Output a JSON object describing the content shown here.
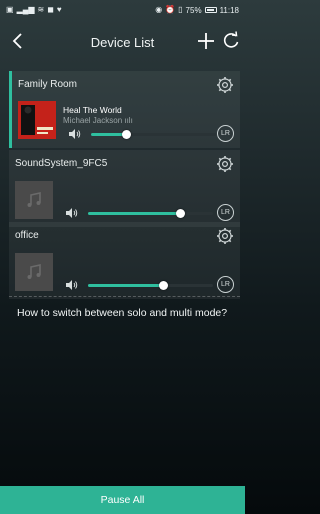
{
  "status": {
    "time": "11:18",
    "battery": "75%"
  },
  "header": {
    "title": "Device List"
  },
  "devices": [
    {
      "name": "Family Room",
      "song": "Heal The World",
      "artist": "Michael Jackson",
      "volume": 0.28,
      "channel": "LR"
    },
    {
      "name": "SoundSystem_9FC5",
      "song": "",
      "artist": "",
      "volume": 0.74,
      "channel": "LR"
    },
    {
      "name": "office",
      "song": "",
      "artist": "",
      "volume": 0.6,
      "channel": "LR"
    }
  ],
  "help": {
    "text": "How to switch between solo and multi mode?"
  },
  "footer": {
    "pause_all": "Pause All"
  },
  "colors": {
    "accent": "#2fbf9f",
    "footer": "#2eb395"
  }
}
